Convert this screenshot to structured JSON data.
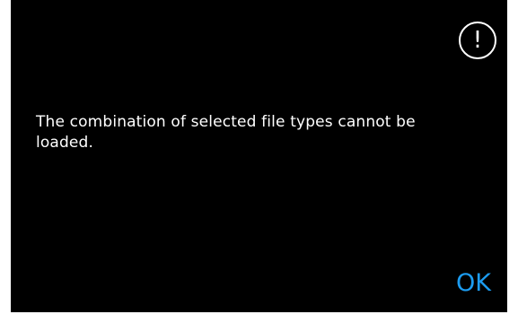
{
  "dialog": {
    "icon": "exclamation-circle-icon",
    "icon_glyph": "!",
    "message": "The combination of selected file types cannot be loaded.",
    "ok_label": "OK"
  },
  "colors": {
    "background": "#000000",
    "text": "#ffffff",
    "accent": "#1c9cf0"
  }
}
